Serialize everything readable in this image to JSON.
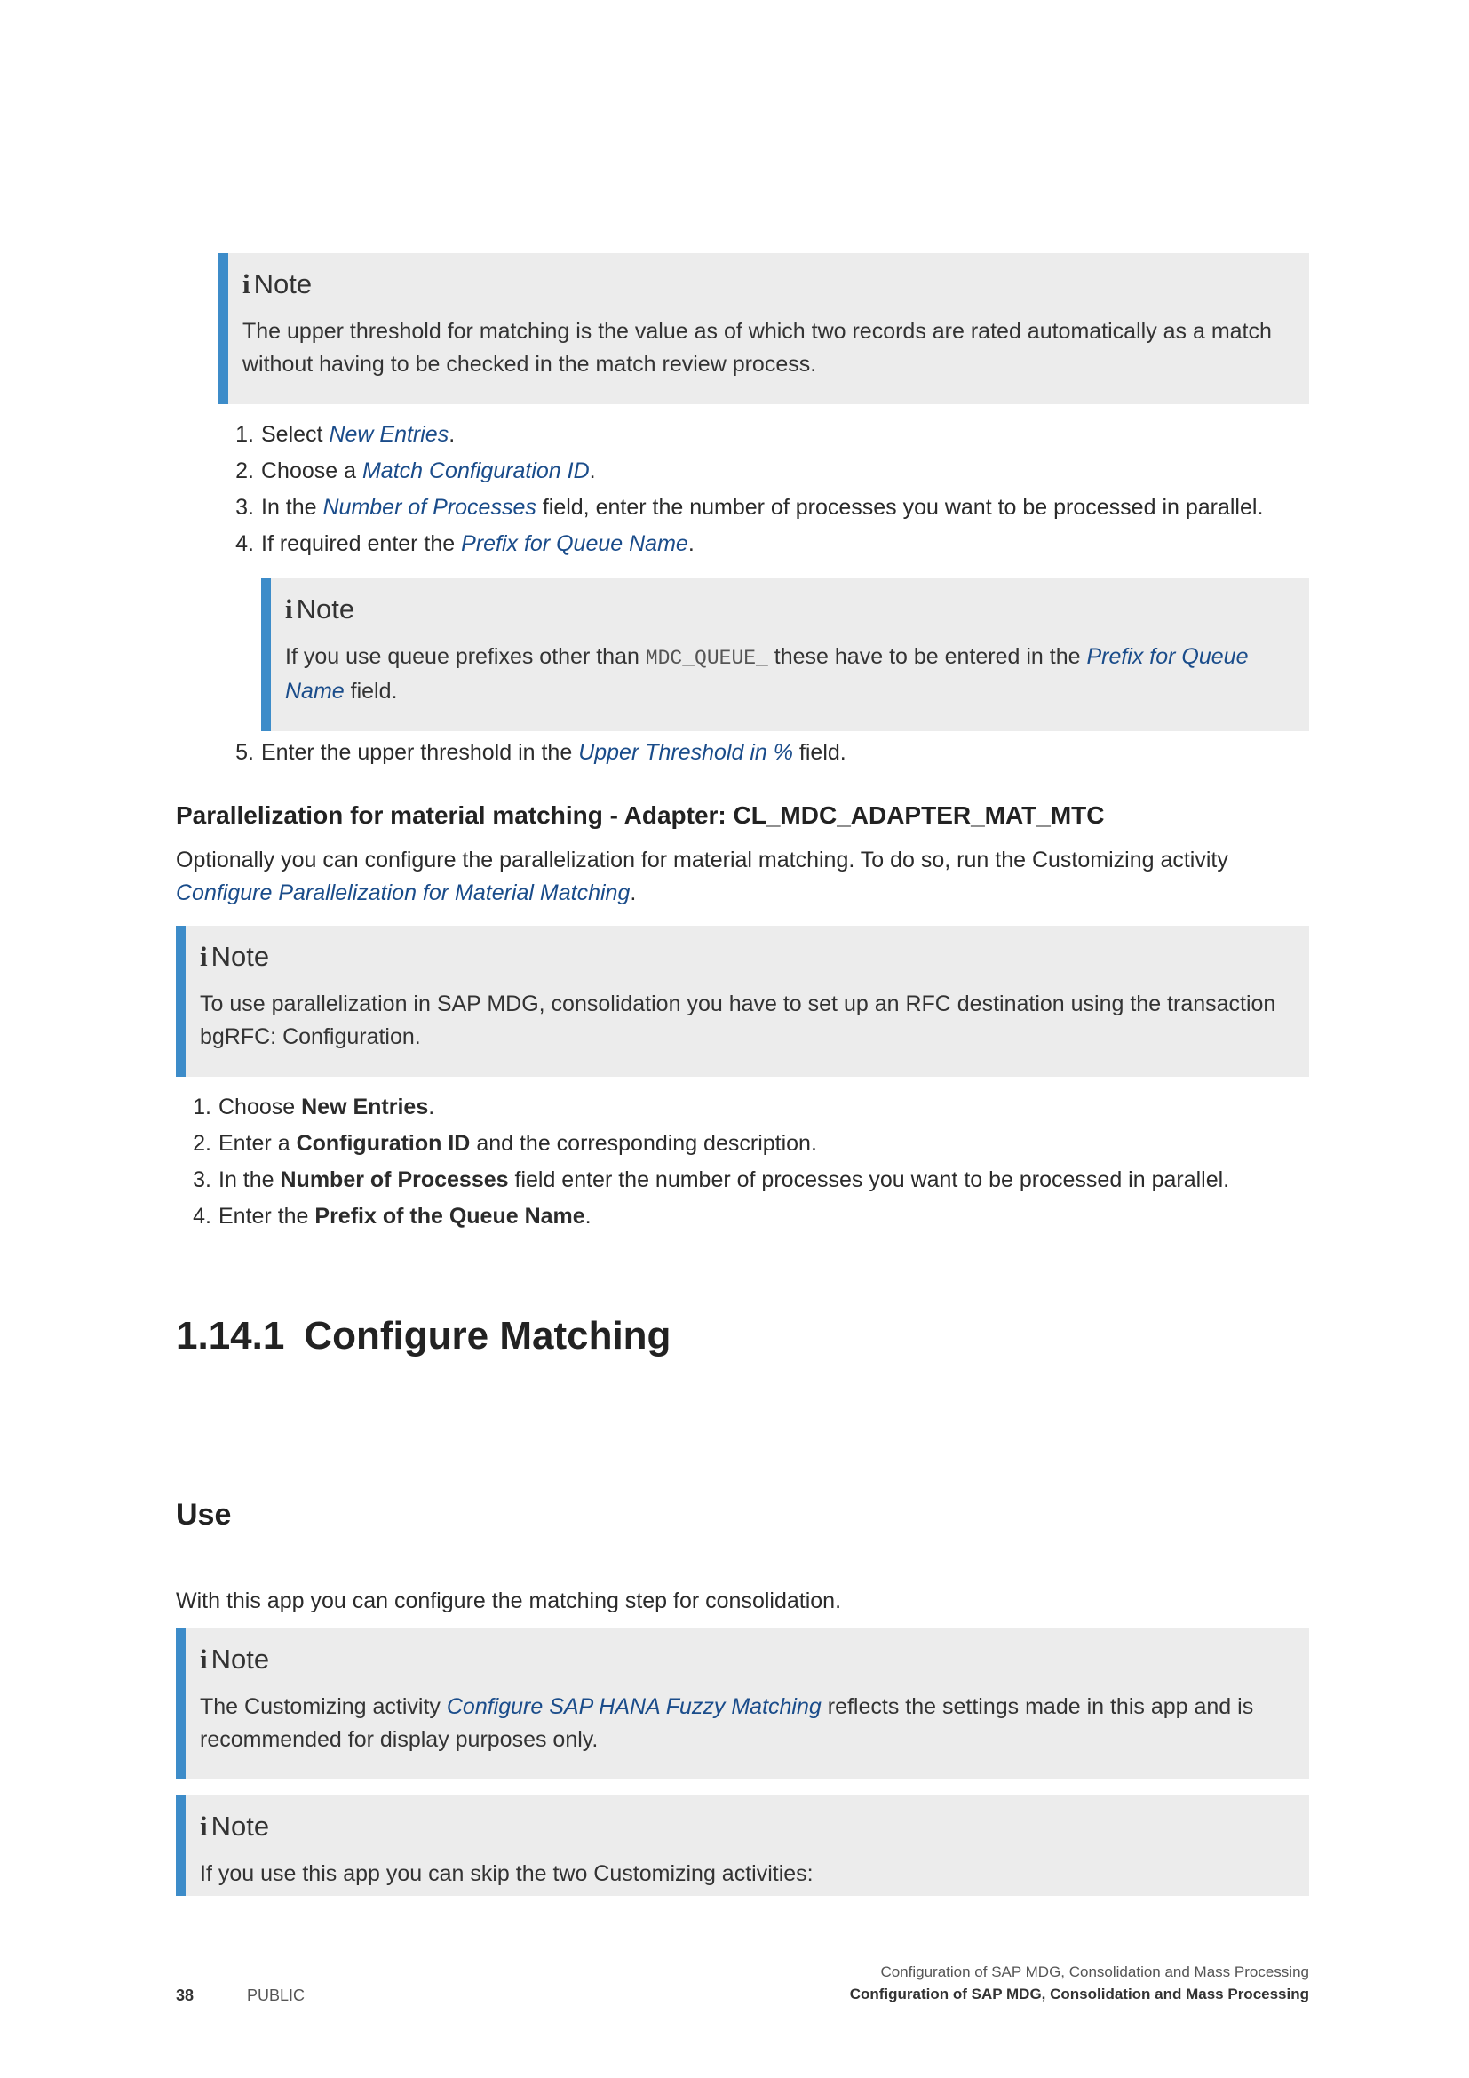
{
  "note_label": "Note",
  "note_icon": "info-icon",
  "accent_color": "#3d8cc9",
  "link_color": "#1a4c8a",
  "note1": {
    "text": "The upper threshold for matching is the value as of which two records are rated automatically as a match without having to be checked in the match review process."
  },
  "steps_a": [
    {
      "num": "1.",
      "pre": "Select ",
      "ref": "New Entries",
      "post": "."
    },
    {
      "num": "2.",
      "pre": "Choose a ",
      "ref": "Match Configuration ID",
      "post": "."
    },
    {
      "num": "3.",
      "pre": "In the ",
      "ref": "Number of Processes",
      "post": " field, enter the number of processes you want to be processed in parallel."
    },
    {
      "num": "4.",
      "pre": "If required enter the ",
      "ref": "Prefix for Queue Name",
      "post": "."
    }
  ],
  "note2": {
    "pre": "If you use queue prefixes other than ",
    "code": "MDC_QUEUE_",
    "mid": " these have to be entered in the ",
    "ref": "Prefix for Queue Name",
    "post": " field."
  },
  "step_a5": {
    "num": "5.",
    "pre": "Enter the upper threshold in the ",
    "ref": "Upper Threshold in %",
    "post": " field."
  },
  "section_parallel": {
    "heading": "Parallelization for material matching - Adapter: CL_MDC_ADAPTER_MAT_MTC",
    "text_pre": "Optionally you can configure the parallelization for material matching. To do so, run the Customizing activity ",
    "ref": "Configure Parallelization for Material Matching",
    "text_post": "."
  },
  "note3": {
    "text": "To use parallelization in SAP MDG, consolidation you have to set up an RFC destination using the transaction bgRFC: Configuration."
  },
  "steps_b": [
    {
      "num": "1.",
      "pre": "Choose ",
      "bold": "New Entries",
      "post": "."
    },
    {
      "num": "2.",
      "pre": "Enter a ",
      "bold": "Configuration ID",
      "post": " and the corresponding description."
    },
    {
      "num": "3.",
      "pre": "In the ",
      "bold": "Number of Processes",
      "post": " field enter the number of processes you want to be processed in parallel."
    },
    {
      "num": "4.",
      "pre": "Enter the ",
      "bold": "Prefix of the Queue Name",
      "post": "."
    }
  ],
  "chapter": {
    "number": "1.14.1",
    "title": "Configure Matching"
  },
  "use_heading": "Use",
  "use_text": "With this app you can configure the matching step for consolidation.",
  "note4": {
    "pre": "The Customizing activity ",
    "ref": "Configure SAP HANA Fuzzy Matching",
    "post": " reflects the settings made in this app and is recommended for display purposes only."
  },
  "note5": {
    "text": "If you use this app you can skip the two Customizing activities:"
  },
  "footer": {
    "page_number": "38",
    "classification": "PUBLIC",
    "doc_title": "Configuration of SAP MDG, Consolidation and Mass Processing",
    "chapter_title": "Configuration of SAP MDG, Consolidation and Mass Processing"
  }
}
